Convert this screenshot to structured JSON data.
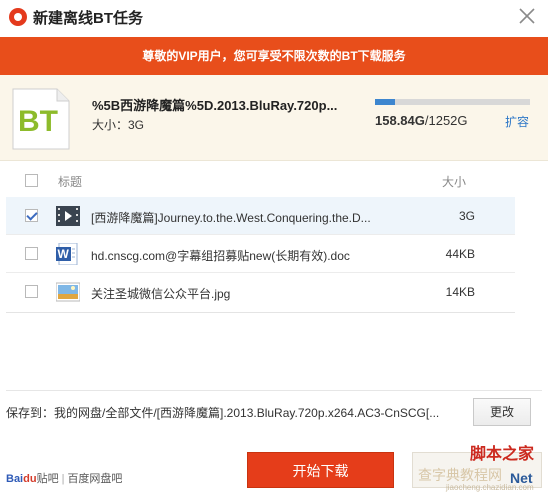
{
  "window": {
    "title": "新建离线BT任务",
    "close_icon": "close-icon"
  },
  "banner": {
    "text": "尊敬的VIP用户，您可享受不限次数的BT下载服务",
    "color": "#e84e1b"
  },
  "torrent": {
    "icon_text": "BT",
    "name": "%5B西游降魔篇%5D.2013.BluRay.720p...",
    "size": "大小：3G"
  },
  "quota": {
    "used_fraction": 0.126,
    "used": "158.84G",
    "total": "/1252G",
    "expand_label": "扩容"
  },
  "list": {
    "header_title": "标题",
    "header_size": "大小",
    "rows": [
      {
        "name": "[西游降魔篇]Journey.to.the.West.Conquering.the.D...",
        "size": "3G",
        "checked": true,
        "icon": "video-file-icon"
      },
      {
        "name": "hd.cnscg.com@字幕组招募贴new(长期有效).doc",
        "size": "44KB",
        "checked": false,
        "icon": "word-doc-icon"
      },
      {
        "name": "关注圣城微信公众平台.jpg",
        "size": "14KB",
        "checked": false,
        "icon": "image-file-icon"
      }
    ]
  },
  "save": {
    "path": "保存到：我的网盘/全部文件/[西游降魔篇].2013.BluRay.720p.x264.AC3-CnSCG[...",
    "change_label": "更改"
  },
  "footer": {
    "brand_bai": "Bai",
    "brand_du": "du",
    "brand_rest": "贴吧",
    "brand_sep": "|",
    "brand_pan": "百度网盘吧",
    "start_label": "开始下载",
    "accent": "#e53d1a"
  },
  "watermark": {
    "line1": "脚本之家",
    "line2": "查字典教程网",
    "line3": "Net",
    "line4": "jiaocheng.chazidian.com"
  }
}
